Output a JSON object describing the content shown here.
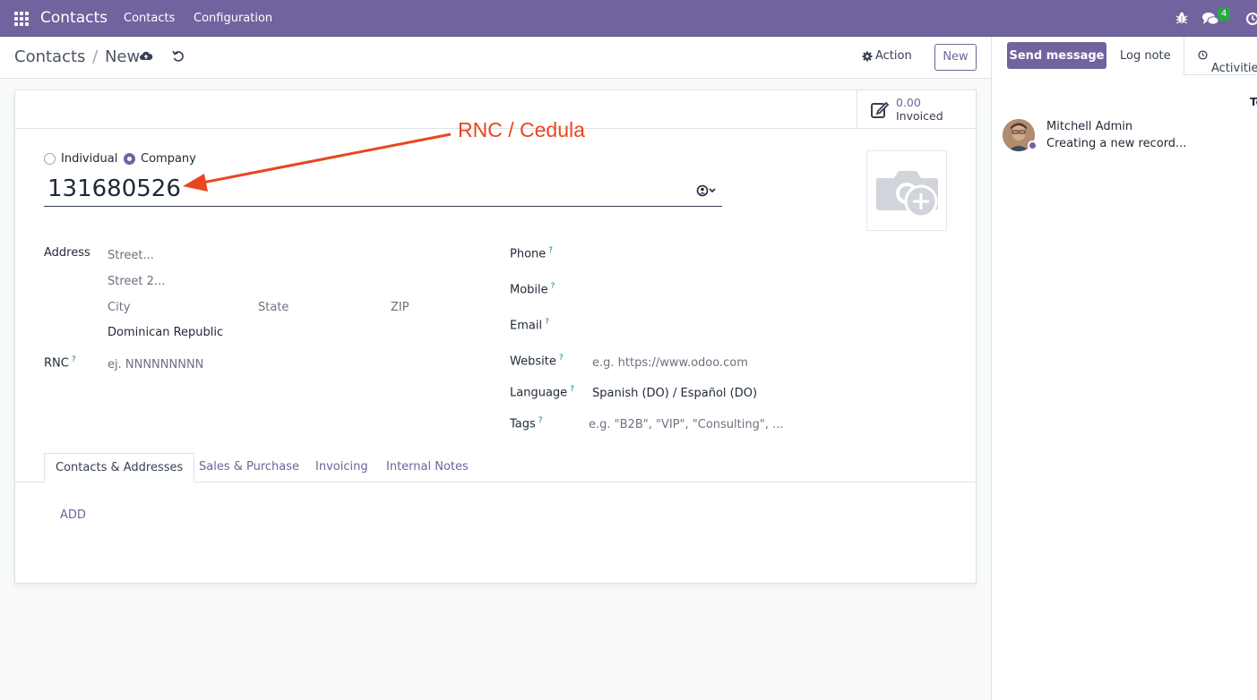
{
  "navbar": {
    "app_name": "Contacts",
    "menus": [
      "Contacts",
      "Configuration"
    ],
    "chat_badge": "4",
    "color": "#71639e"
  },
  "control_panel": {
    "breadcrumb_parent": "Contacts",
    "breadcrumb_separator": "/",
    "breadcrumb_current": "New",
    "action_label": "Action",
    "new_label": "New"
  },
  "stat_button": {
    "value": "0.00",
    "label": "Invoiced"
  },
  "company_type": {
    "options": [
      "Individual",
      "Company"
    ],
    "selected": "Company"
  },
  "name_value": "131680526",
  "annotation": "RNC / Cedula",
  "left_fields": {
    "address_label": "Address",
    "street_placeholder": "Street...",
    "street2_placeholder": "Street 2...",
    "city_placeholder": "City",
    "state_placeholder": "State",
    "zip_placeholder": "ZIP",
    "country_value": "Dominican Republic",
    "rnc_label": "RNC",
    "rnc_help": "?",
    "rnc_placeholder": "ej. NNNNNNNNN"
  },
  "right_fields": {
    "phone_label": "Phone",
    "mobile_label": "Mobile",
    "email_label": "Email",
    "website_label": "Website",
    "website_placeholder": "e.g. https://www.odoo.com",
    "language_label": "Language",
    "language_value": "Spanish (DO) / Español (DO)",
    "tags_label": "Tags",
    "tags_placeholder": "e.g. \"B2B\", \"VIP\", \"Consulting\", ...",
    "help": "?"
  },
  "tabs": [
    "Contacts & Addresses",
    "Sales & Purchase",
    "Invoicing",
    "Internal Notes"
  ],
  "add_label": "ADD",
  "chatter": {
    "send_message": "Send message",
    "log_note": "Log note",
    "activities": "Activities",
    "today": "To",
    "author": "Mitchell Admin",
    "body": "Creating a new record..."
  }
}
